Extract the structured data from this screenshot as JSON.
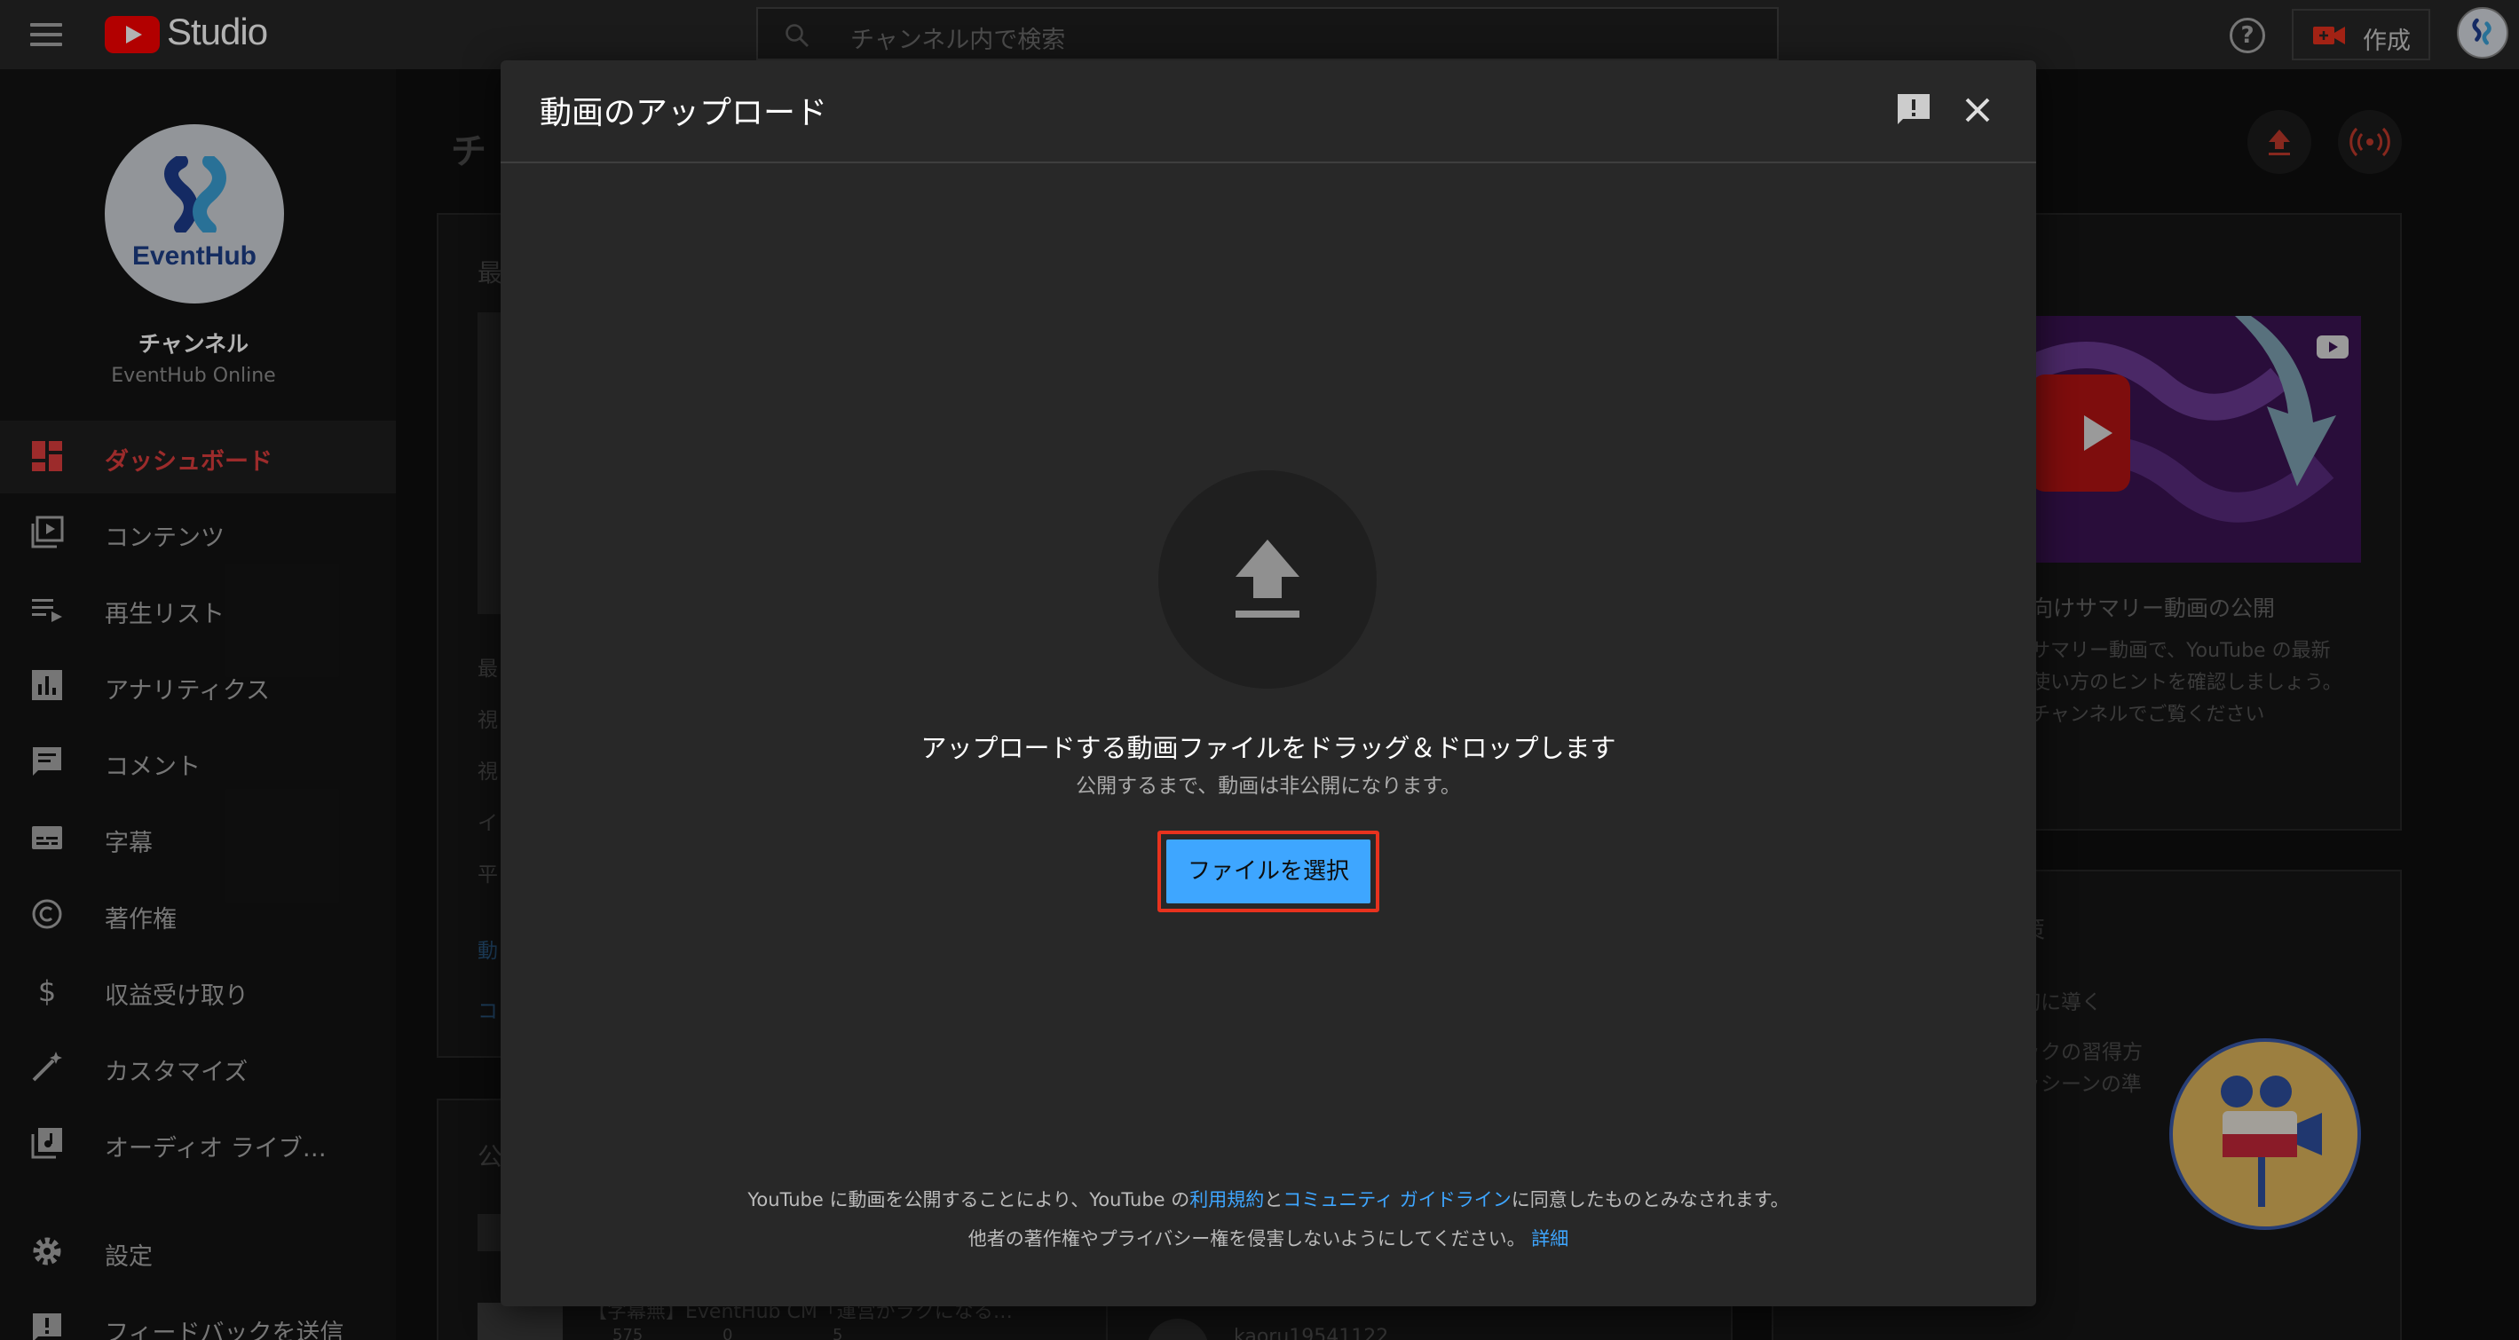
{
  "topbar": {
    "logo_text": "Studio",
    "search_placeholder": "チャンネル内で検索",
    "help_glyph": "?",
    "create_label": "作成",
    "avatar_text": "EventHub"
  },
  "sidebar": {
    "channel_logo_text": "EventHub",
    "channel_title": "チャンネル",
    "channel_subtitle": "EventHub Online",
    "items": [
      {
        "label": "ダッシュボード",
        "icon": "dashboard-icon",
        "active": true
      },
      {
        "label": "コンテンツ",
        "icon": "content-icon"
      },
      {
        "label": "再生リスト",
        "icon": "playlist-icon"
      },
      {
        "label": "アナリティクス",
        "icon": "analytics-icon"
      },
      {
        "label": "コメント",
        "icon": "comment-icon"
      },
      {
        "label": "字幕",
        "icon": "subtitles-icon"
      },
      {
        "label": "著作権",
        "icon": "copyright-icon"
      },
      {
        "label": "収益受け取り",
        "icon": "monetization-icon"
      },
      {
        "label": "カスタマイズ",
        "icon": "customize-icon"
      },
      {
        "label": "オーディオ ライブ…",
        "icon": "audio-library-icon"
      },
      {
        "label": "設定",
        "icon": "settings-icon"
      },
      {
        "label": "フィードバックを送信",
        "icon": "feedback-icon"
      }
    ]
  },
  "background": {
    "page_title": "チ",
    "card_left_heading": "最",
    "side_labels": [
      "最",
      "視",
      "視",
      "イ",
      "平",
      "動",
      "コ"
    ],
    "section_heading": "公",
    "video_title": "【字幕無】EventHub CM「運営がラクになる…",
    "video_stats": [
      "575",
      "0",
      "5"
    ],
    "username": "kaoru19541122",
    "promo_title": "向けサマリー動画の公開",
    "promo_lines": [
      "サマリー動画で、YouTube の最新",
      "使い方のヒントを確認しましょう。",
      "チャンネルでご覧ください"
    ],
    "second_card_heading": "策",
    "second_card_lines": [
      "切に導く",
      "ックの習得方",
      "ッシーンの準"
    ]
  },
  "modal": {
    "title": "動画のアップロード",
    "drop_text": "アップロードする動画ファイルをドラッグ＆ドロップします",
    "private_text": "公開するまで、動画は非公開になります。",
    "select_button": "ファイルを選択",
    "terms_part1": "YouTube に動画を公開することにより、YouTube の",
    "terms_link1": "利用規約",
    "terms_part2": "と",
    "terms_link2": "コミュニティ ガイドライン",
    "terms_part3": "に同意したものとみなされます。",
    "terms_line2": "他者の著作権やプライバシー権を侵害しないようにしてください。",
    "terms_link3": "詳細"
  },
  "colors": {
    "accent_blue": "#3ea6ff",
    "active_red": "#e03e3e",
    "highlight_red": "#e8321e",
    "modal_bg": "#282828"
  }
}
